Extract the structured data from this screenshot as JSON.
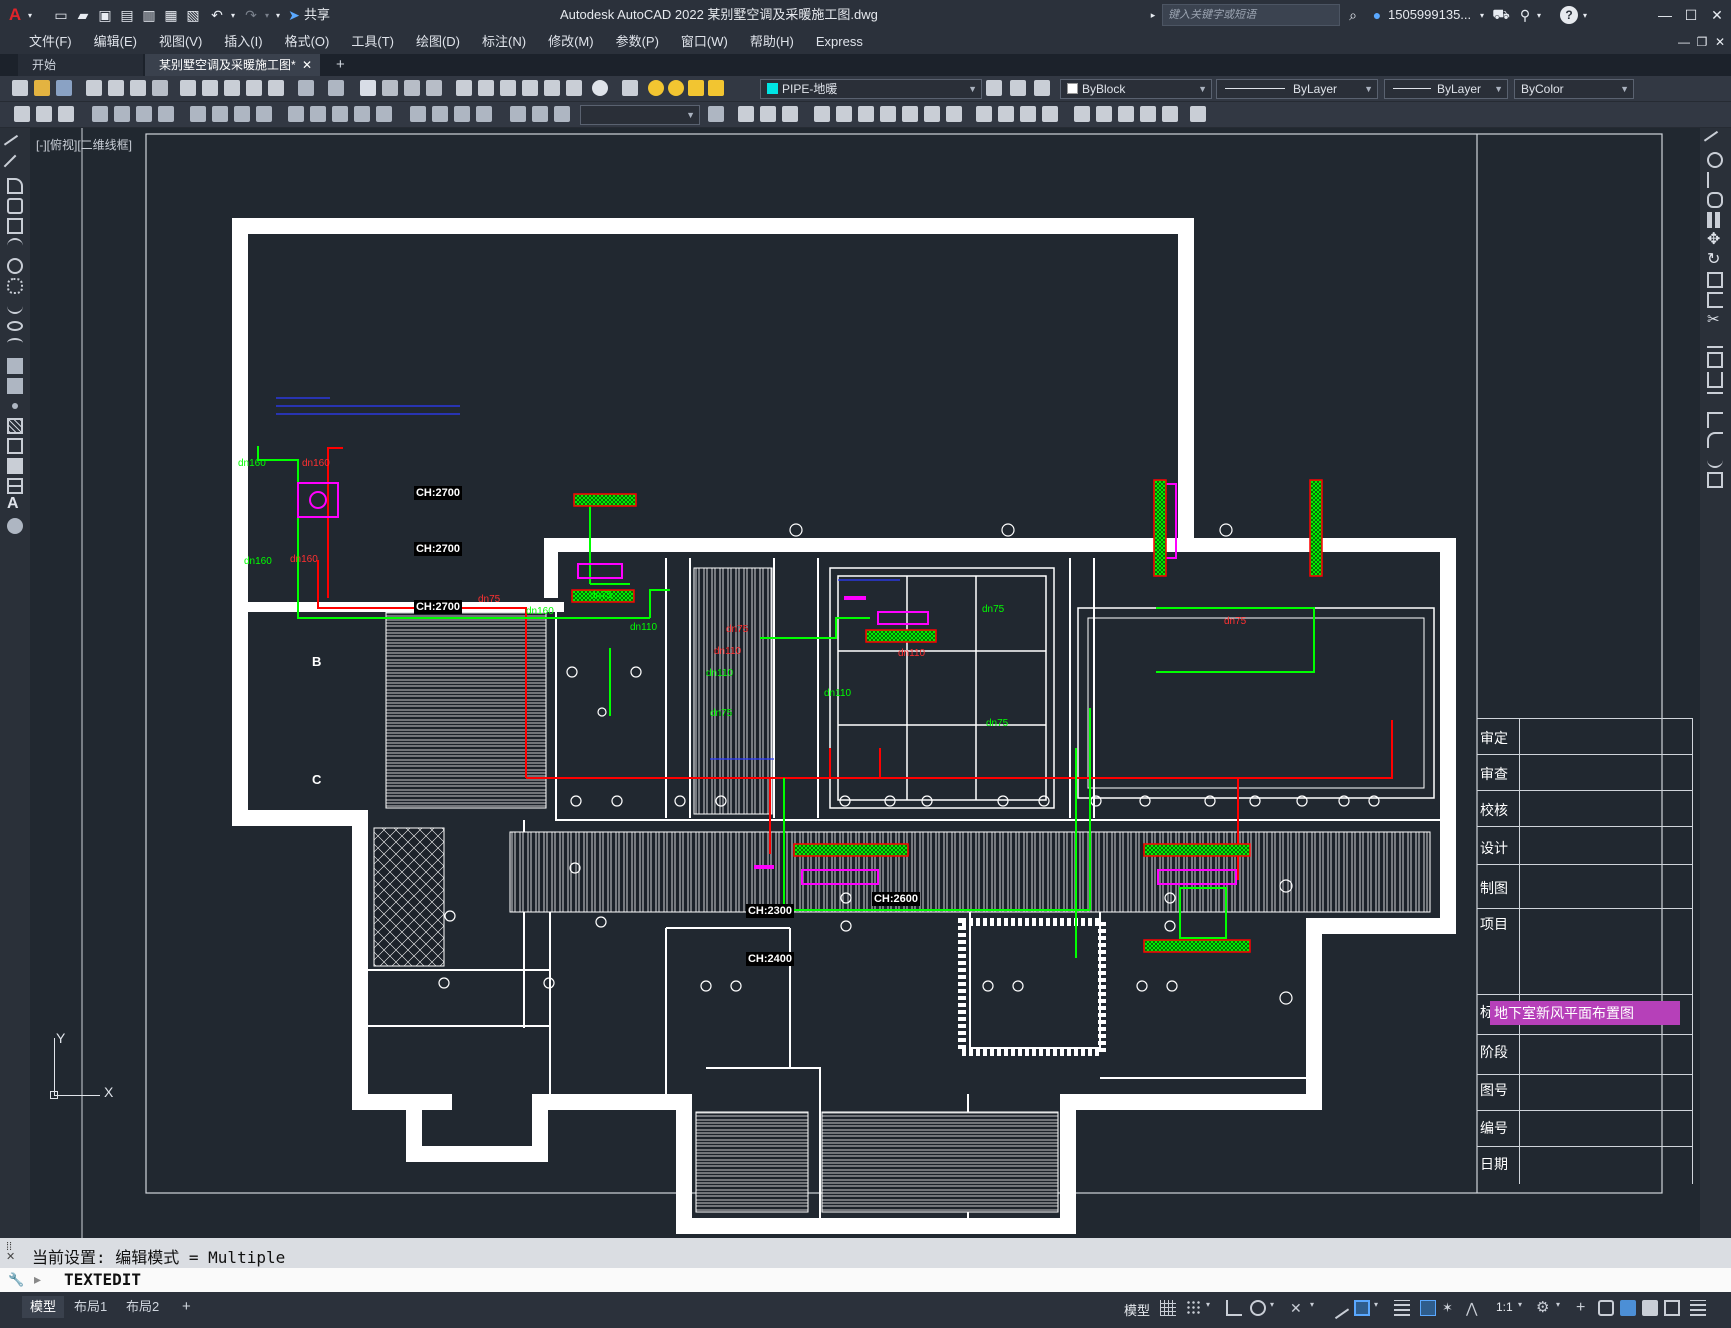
{
  "app": {
    "logo_letter": "A",
    "window_title": "Autodesk AutoCAD 2022    某别墅空调及采暖施工图.dwg",
    "share_label": "共享",
    "search_placeholder": "键入关键字或短语",
    "user_name": "1505999135...",
    "help_label": "?"
  },
  "menu": [
    "文件(F)",
    "编辑(E)",
    "视图(V)",
    "插入(I)",
    "格式(O)",
    "工具(T)",
    "绘图(D)",
    "标注(N)",
    "修改(M)",
    "参数(P)",
    "窗口(W)",
    "帮助(H)",
    "Express"
  ],
  "tabs": {
    "start": "开始",
    "drawing": "某别墅空调及采暖施工图*",
    "add": "+"
  },
  "toolbar": {
    "layer": "PIPE-地暖",
    "color": "ByBlock",
    "linetype": "ByLayer",
    "lineweight": "ByLayer",
    "plotstyle": "ByColor",
    "dimstyle": ""
  },
  "viewport": {
    "label": "[-][俯视][二维线框]"
  },
  "drawing": {
    "room_labels": [
      "CH:2700",
      "CH:2700",
      "CH:2700",
      "CH:2300",
      "CH:2600",
      "CH:2400"
    ],
    "grid_labels": [
      "B",
      "C"
    ],
    "pipe_labels_green": [
      "dn160",
      "dn160",
      "dn160",
      "dn75",
      "dn110",
      "dn110",
      "dn75",
      "dn75",
      "dn110",
      "dn75"
    ],
    "pipe_labels_red": [
      "dn160",
      "dn160",
      "dn75",
      "dn75",
      "dn110",
      "dn75",
      "dn110"
    ],
    "ucs_x": "X",
    "ucs_y": "Y"
  },
  "title_block": {
    "rows": [
      "审定",
      "审查",
      "校核",
      "设计",
      "制图",
      "项目",
      "标题",
      "阶段",
      "图号",
      "编号",
      "日期"
    ],
    "title_value": "地下室新风平面布置图"
  },
  "command": {
    "history": "当前设置: 编辑模式 = Multiple",
    "input": "TEXTEDIT"
  },
  "status": {
    "layout_tabs": [
      "模型",
      "布局1",
      "布局2"
    ],
    "add_layout": "+",
    "model_label": "模型",
    "scale": "1:1"
  },
  "colors": {
    "background": "#212830",
    "wall": "#ffffff",
    "pipe_supply": "#00ff00",
    "pipe_return": "#ff0000",
    "equipment": "#ff00ff",
    "annotation": "#0000ff",
    "title_highlight": "#b640b9"
  }
}
